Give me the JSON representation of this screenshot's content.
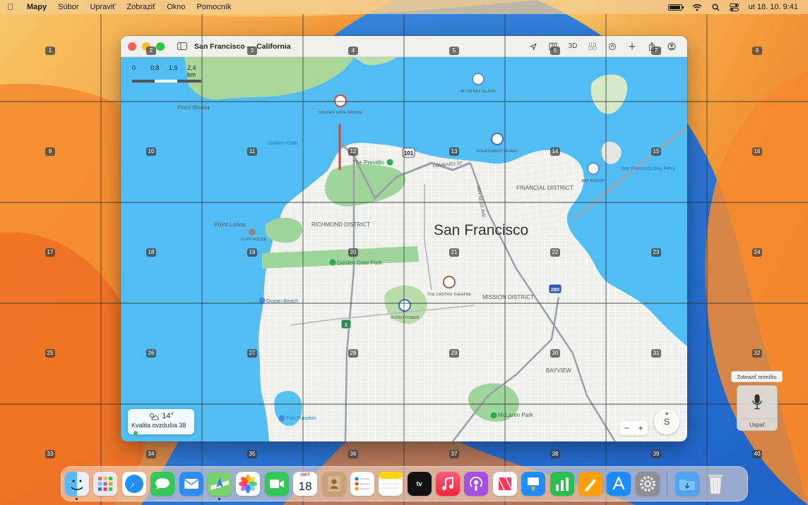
{
  "menubar": {
    "app_name": "Mapy",
    "menus": [
      "Súbor",
      "Upraviť",
      "Zobraziť",
      "Okno",
      "Pomocník"
    ],
    "clock": "ut 18. 10.  9:41"
  },
  "window": {
    "title": "San Francisco — California",
    "toolbar_3d": "3D",
    "scale_labels": [
      "0",
      "0,8",
      "1,6",
      "2,4 km"
    ],
    "weather_temp": "14°",
    "weather_air_quality": "Kvalita ovzdušia 38",
    "compass_label": "S",
    "zoom_out": "−",
    "zoom_in": "+"
  },
  "map": {
    "city_label": "San Francisco",
    "districts": [
      "RICHMOND DISTRICT",
      "FINANCIAL DISTRICT",
      "MISSION DISTRICT",
      "BAYVIEW"
    ],
    "places": [
      "Point Bonita",
      "Golden Gate",
      "Point Lobos",
      "The Presidio",
      "Golden Gate Park",
      "Ocean Beach",
      "Fort Funston",
      "McLaren Park",
      "San Francisco Bay Ferry",
      "LOMBARD ST",
      "VAN NESS AVE"
    ],
    "landmarks": [
      "GOLDEN GATE BRIDGE",
      "ALCATRAZ ISLAND",
      "FISHERMAN'S WHARF",
      "BAY BRIDGE",
      "CLIFF HOUSE",
      "THE CASTRO THEATRE",
      "SUTRO TOWER"
    ],
    "highway_shields": [
      "101",
      "280",
      "1"
    ]
  },
  "grid": {
    "numbers": [
      "1",
      "2",
      "3",
      "4",
      "5",
      "6",
      "7",
      "8",
      "9",
      "10",
      "11",
      "12",
      "13",
      "14",
      "15",
      "16",
      "17",
      "18",
      "19",
      "20",
      "21",
      "22",
      "23",
      "24",
      "25",
      "26",
      "27",
      "28",
      "29",
      "30",
      "31",
      "32",
      "33",
      "34",
      "35",
      "36",
      "37",
      "38",
      "39",
      "40"
    ]
  },
  "voice_control": {
    "tooltip": "Zobraziť mriežku",
    "sleep_label": "Uspať"
  },
  "dock": {
    "calendar_month": "OKT",
    "calendar_day": "18",
    "tv_label": "tv",
    "items": [
      "finder-icon",
      "launchpad-icon",
      "safari-icon",
      "messages-icon",
      "mail-icon",
      "maps-icon",
      "photos-icon",
      "facetime-icon",
      "calendar-icon",
      "contacts-icon",
      "reminders-icon",
      "notes-icon",
      "tv-icon",
      "music-icon",
      "podcasts-icon",
      "news-icon",
      "keynote-icon",
      "numbers-icon",
      "pages-icon",
      "app-store-icon",
      "system-settings-icon",
      "downloads-icon",
      "trash-icon"
    ]
  }
}
